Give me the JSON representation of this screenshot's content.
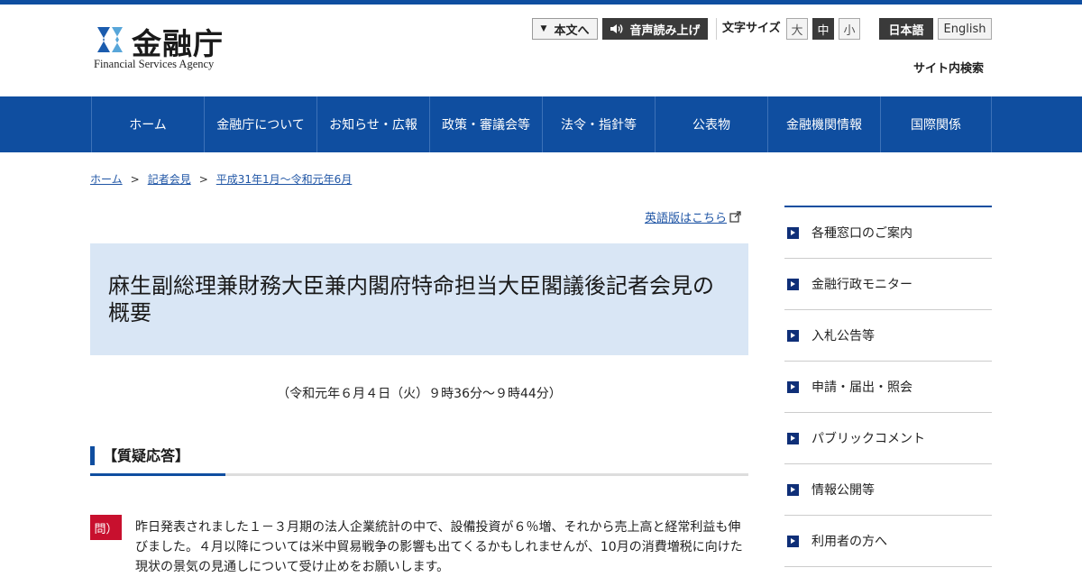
{
  "header": {
    "logo_name": "金融庁",
    "logo_sub": "Financial Services Agency",
    "skip_label": "本文へ",
    "speech_label": "音声読み上げ",
    "font_size_label": "文字サイズ",
    "font_sizes": [
      "大",
      "中",
      "小"
    ],
    "lang_ja": "日本語",
    "lang_en": "English",
    "site_search": "サイト内検索"
  },
  "nav": {
    "items": [
      {
        "label": "ホーム"
      },
      {
        "label": "金融庁について"
      },
      {
        "label": "お知らせ・広報"
      },
      {
        "label": "政策・審議会等"
      },
      {
        "label": "法令・指針等"
      },
      {
        "label": "公表物"
      },
      {
        "label": "金融機関情報"
      },
      {
        "label": "国際関係"
      }
    ]
  },
  "breadcrumb": {
    "items": [
      "ホーム",
      "記者会見",
      "平成31年1月～令和元年6月"
    ],
    "separator": ">"
  },
  "main": {
    "english_link": "英語版はこちら",
    "title": "麻生副総理兼財務大臣兼内閣府特命担当大臣閣議後記者会見の概要",
    "date": "（令和元年６月４日（火）９時36分～９時44分）",
    "section_title": "【質疑応答】",
    "question_badge": "問）",
    "question_text": "昨日発表されました１－３月期の法人企業統計の中で、設備投資が６％増、それから売上高と経常利益も伸びました。４月以降については米中貿易戦争の影響も出てくるかもしれませんが、10月の消費増税に向けた現状の景気の見通しについて受け止めをお願いします。"
  },
  "sidebar": {
    "items": [
      {
        "label": "各種窓口のご案内"
      },
      {
        "label": "金融行政モニター"
      },
      {
        "label": "入札公告等"
      },
      {
        "label": "申請・届出・照会"
      },
      {
        "label": "パブリックコメント"
      },
      {
        "label": "情報公開等"
      },
      {
        "label": "利用者の方へ"
      }
    ]
  },
  "colors": {
    "brand_blue": "#0f4ea0",
    "title_bg": "#d9e6f5",
    "question_badge": "#c8102e"
  },
  "icons": [
    "speaker-icon",
    "external-link-icon",
    "sidebar-arrow-icon",
    "triangle-down-icon"
  ]
}
